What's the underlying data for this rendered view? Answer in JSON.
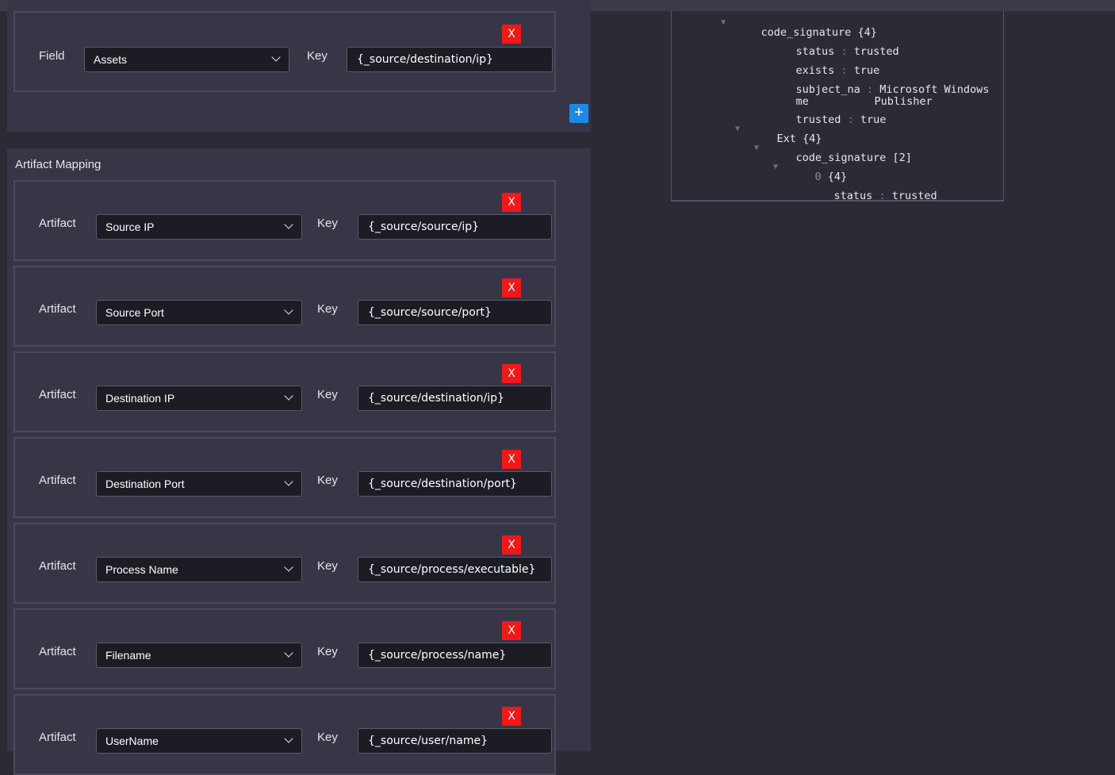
{
  "field_mapping": {
    "row": {
      "label": "Field",
      "selected": "Assets",
      "key_label": "Key",
      "key_value": "{_source/destination/ip}",
      "delete_label": "X"
    },
    "add_label": "+"
  },
  "artifact_mapping": {
    "title": "Artifact Mapping",
    "rows": [
      {
        "label": "Artifact",
        "selected": "Source IP",
        "key_label": "Key",
        "key_value": "{_source/source/ip}",
        "delete_label": "X"
      },
      {
        "label": "Artifact",
        "selected": "Source Port",
        "key_label": "Key",
        "key_value": "{_source/source/port}",
        "delete_label": "X"
      },
      {
        "label": "Artifact",
        "selected": "Destination IP",
        "key_label": "Key",
        "key_value": "{_source/destination/ip}",
        "delete_label": "X"
      },
      {
        "label": "Artifact",
        "selected": "Destination Port",
        "key_label": "Key",
        "key_value": "{_source/destination/port}",
        "delete_label": "X"
      },
      {
        "label": "Artifact",
        "selected": "Process Name",
        "key_label": "Key",
        "key_value": "{_source/process/executable}",
        "delete_label": "X"
      },
      {
        "label": "Artifact",
        "selected": "Filename",
        "key_label": "Key",
        "key_value": "{_source/process/name}",
        "delete_label": "X"
      },
      {
        "label": "Artifact",
        "selected": "UserName",
        "key_label": "Key",
        "key_value": "{_source/user/name}",
        "delete_label": "X"
      }
    ]
  },
  "json_tree": {
    "code_signature_node": {
      "key": "code_signature",
      "count": "{4}"
    },
    "status": {
      "key": "status",
      "value": "trusted"
    },
    "exists": {
      "key": "exists",
      "value": "true"
    },
    "subject_name": {
      "key_line1": "subject_na",
      "key_line2": "me",
      "value_line1": "Microsoft Windows",
      "value_line2": "Publisher"
    },
    "trusted": {
      "key": "trusted",
      "value": "true"
    },
    "ext_node": {
      "key": "Ext",
      "count": "{4}"
    },
    "ext_code_signature_node": {
      "key": "code_signature",
      "count": "[2]"
    },
    "index_node": {
      "index": "0",
      "count": "{4}"
    },
    "inner_status": {
      "key": "status",
      "value": "trusted"
    },
    "colon": ":"
  },
  "colors": {
    "delete": "#f01818",
    "add": "#1e88e5",
    "background": "#2b2b36",
    "panel": "#363646"
  }
}
